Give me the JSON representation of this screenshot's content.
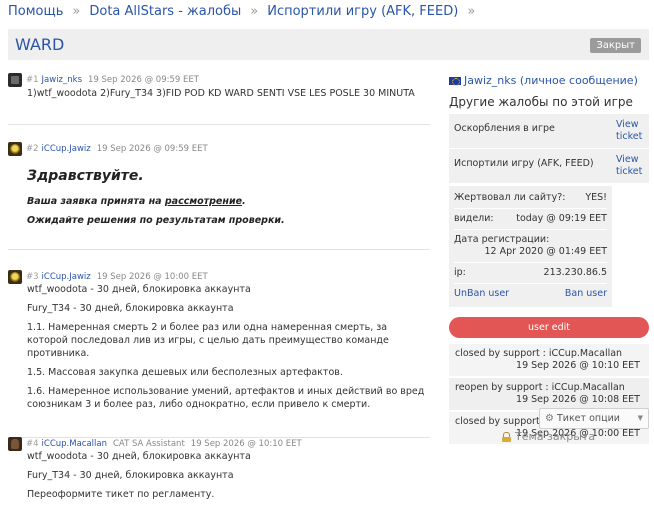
{
  "breadcrumb": {
    "items": [
      "Помощь",
      "Dota AllStars - жалобы",
      "Испортили игру (AFK, FEED)"
    ],
    "separator": "»"
  },
  "ticket": {
    "title": "WARD",
    "status_badge": "Закрыт"
  },
  "posts": [
    {
      "number": "#1",
      "author": "Jawiz_nks",
      "date": "19 Sep 2026 @ 09:59 EET",
      "lines": [
        "1)wtf_woodota 2)Fury_T34 3)FID POD KD WARD SENTI VSE LES POSLE 30 MINUTA"
      ]
    },
    {
      "number": "#2",
      "author": "iCCup.Jawiz",
      "date": "19 Sep 2026 @ 09:59 EET",
      "greeting": "Здравствуйте.",
      "line1_prefix": "Ваша заявка принята на ",
      "line1_link": "рассмотрение",
      "line1_suffix": ".",
      "line2": "Ожидайте решения по результатам проверки."
    },
    {
      "number": "#3",
      "author": "iCCup.Jawiz",
      "date": "19 Sep 2026 @ 10:00 EET",
      "lines": [
        "wtf_woodota - 30 дней, блокировка аккаунта",
        "Fury_T34 - 30 дней, блокировка аккаунта",
        "1.1. Намеренная смерть 2 и более раз или одна намеренная смерть, за которой последовал лив из игры, с целью дать преимущество команде противника.",
        "1.5. Массовая закупка дешевых или бесполезных артефактов.",
        "1.6. Намеренное использование умений, артефактов и иных действий во вред союзникам 3 и более раз, либо однократно, если привело к смерти."
      ]
    },
    {
      "number": "#4",
      "author": "iCCup.Macallan",
      "role": "CAT SA Assistant",
      "date": "19 Sep 2026 @ 10:10 EET",
      "lines": [
        "wtf_woodota - 30 дней, блокировка аккаунта",
        "Fury_T34 - 30 дней, блокировка аккаунта",
        "Переоформите тикет по регламенту."
      ]
    }
  ],
  "sidebar": {
    "user": "Jawiz_nks",
    "user_suffix": "(личное сообщение)",
    "heading": "Другие жалобы по этой игре",
    "categories": [
      {
        "name": "Оскорбления в игре",
        "link": "View ticket"
      },
      {
        "name": "Испортили игру (AFK, FEED)",
        "link": "View ticket"
      }
    ],
    "info": {
      "donated_label": "Жертвовал ли сайту?:",
      "donated_value": "YES!",
      "seen_label": "видели:",
      "seen_value": "today @ 09:19 EET",
      "reg_label": "Дата регистрации:",
      "reg_value": "12 Apr 2020 @ 01:49 EET",
      "ip_label": "ip:",
      "ip_value": "213.230.86.5",
      "unban": "UnBan user",
      "ban": "Ban user"
    },
    "edit_button": "user edit",
    "log": [
      {
        "action": "closed by support : iCCup.Macallan",
        "date": "19 Sep 2026 @ 10:10 EET"
      },
      {
        "action": "reopen by support : iCCup.Macallan",
        "date": "19 Sep 2026 @ 10:08 EET"
      },
      {
        "action": "closed by support : iCCup.Jawiz",
        "date": "19 Sep 2026 @ 10:00 EET"
      }
    ],
    "options_label": "Тикет опции",
    "locked_label": "Тема закрыта"
  }
}
